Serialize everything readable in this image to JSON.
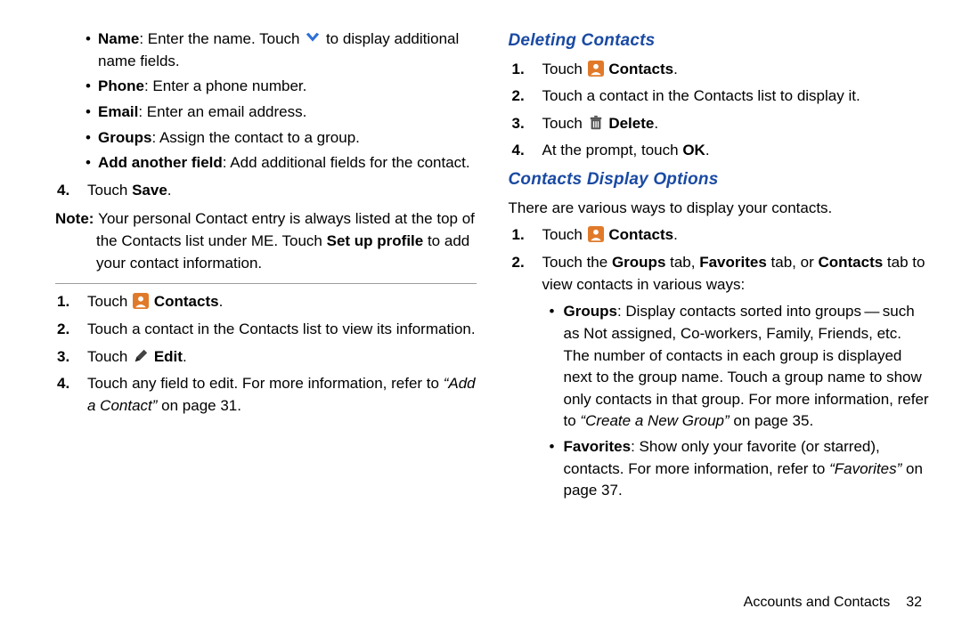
{
  "left": {
    "bullets": [
      {
        "lead": "Name",
        "tail_a": ": Enter the name. Touch ",
        "tail_b": " to display additional name fields."
      },
      {
        "lead": "Phone",
        "tail": ": Enter a phone number."
      },
      {
        "lead": "Email",
        "tail": ": Enter an email address."
      },
      {
        "lead": "Groups",
        "tail": ": Assign the contact to a group."
      },
      {
        "lead": "Add another field",
        "tail": ": Add additional fields for the contact."
      }
    ],
    "step4_num": "4.",
    "step4_a": "Touch ",
    "step4_b": "Save",
    "step4_c": ".",
    "note_label": "Note: ",
    "note_a": "Your personal Contact entry is always listed at the top of the Contacts list under ME. Touch ",
    "note_b": "Set up profile",
    "note_c": " to add your contact information.",
    "steps2": {
      "s1_num": "1.",
      "s1_a": "Touch ",
      "s1_b": "Contacts",
      "s1_c": ".",
      "s2_num": "2.",
      "s2": "Touch a contact in the Contacts list to view its information.",
      "s3_num": "3.",
      "s3_a": "Touch ",
      "s3_b": "Edit",
      "s3_c": ".",
      "s4_num": "4.",
      "s4_a": "Touch any field to edit. For more information, refer to ",
      "s4_ref": "“Add a Contact”",
      "s4_b": " on page 31."
    }
  },
  "right": {
    "h1": "Deleting Contacts",
    "del": {
      "s1_num": "1.",
      "s1_a": "Touch ",
      "s1_b": "Contacts",
      "s1_c": ".",
      "s2_num": "2.",
      "s2": "Touch a contact in the Contacts list to display it.",
      "s3_num": "3.",
      "s3_a": "Touch ",
      "s3_b": "Delete",
      "s3_c": ".",
      "s4_num": "4.",
      "s4_a": "At the prompt, touch ",
      "s4_b": "OK",
      "s4_c": "."
    },
    "h2": "Contacts Display Options",
    "intro": "There are various ways to display your contacts.",
    "disp": {
      "s1_num": "1.",
      "s1_a": "Touch ",
      "s1_b": "Contacts",
      "s1_c": ".",
      "s2_num": "2.",
      "s2_a": "Touch the ",
      "s2_b": "Groups",
      "s2_c": " tab, ",
      "s2_d": "Favorites",
      "s2_e": " tab, or ",
      "s2_f": "Contacts",
      "s2_g": " tab to view contacts in various ways:"
    },
    "sub": {
      "g_lead": "Groups",
      "g_a": ": Display contacts sorted into groups — such as Not assigned, Co-workers, Family, Friends, etc. The number of contacts in each group is displayed next to the group name. Touch a group name to show only contacts in that group. For more information, refer to ",
      "g_ref": "“Create a New Group”",
      "g_b": " on page 35.",
      "f_lead": "Favorites",
      "f_a": ": Show only your favorite (or starred), contacts. For more information, refer to ",
      "f_ref": "“Favorites”",
      "f_b": " on page 37."
    }
  },
  "footer": {
    "section": "Accounts and Contacts",
    "page": "32"
  }
}
